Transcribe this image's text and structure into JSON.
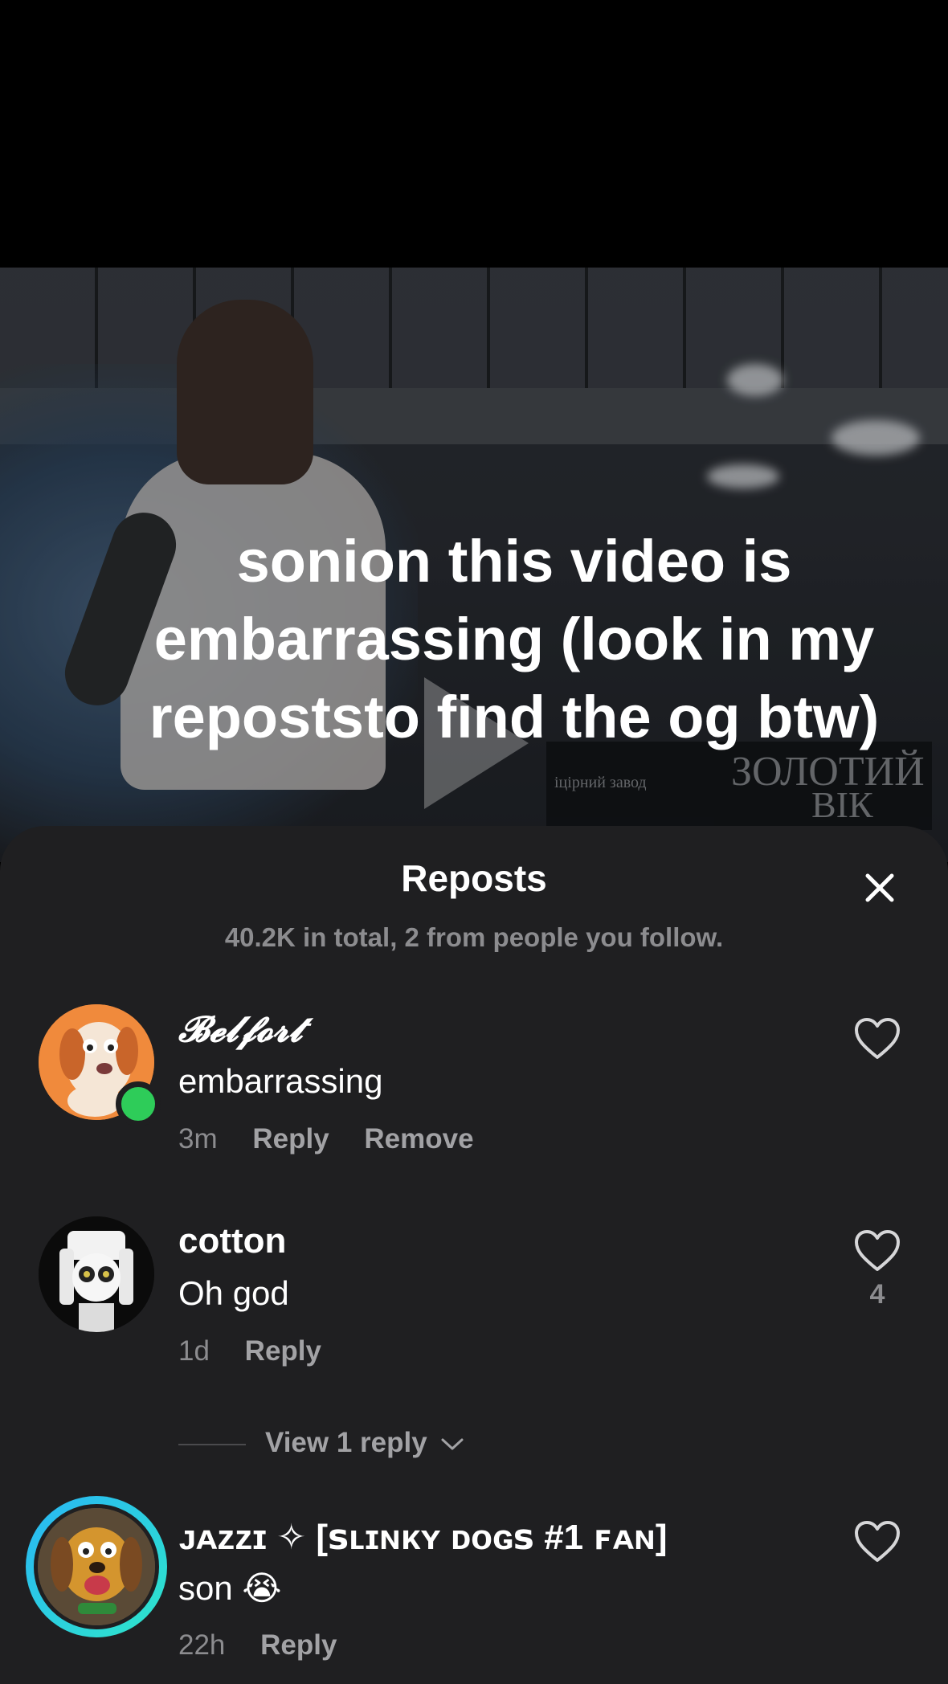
{
  "video": {
    "caption": "sonion this video is embarrassing (look in my repoststo find the og btw)",
    "sign_small": "іцірний завод",
    "sign_big_1": "ЗОЛОТИЙ",
    "sign_big_2": "ВІК"
  },
  "sheet": {
    "title": "Reposts",
    "subtitle": "40.2K in total, 2 from people you follow.",
    "view_replies_label": "View 1 reply"
  },
  "comments": [
    {
      "username": "𝓑𝓮𝓵𝓯𝓸𝓻𝓽",
      "text": "embarrassing",
      "time": "3m",
      "reply_label": "Reply",
      "remove_label": "Remove",
      "online": true
    },
    {
      "username": "cotton",
      "text": "Oh god",
      "time": "1d",
      "reply_label": "Reply",
      "likes": "4"
    },
    {
      "username": "ᴊᴀᴢᴢɪ ✧ [ꜱʟɪɴᴋʏ ᴅᴏɢꜱ #1 ꜰᴀɴ]",
      "text": "son 😭",
      "time": "22h",
      "reply_label": "Reply"
    }
  ],
  "icons": {
    "close": "close-icon",
    "like": "heart-outline-icon",
    "expand": "chevron-down-icon",
    "play": "play-icon"
  },
  "colors": {
    "sheet_bg": "#1f1f21",
    "muted_text": "#8c8c8f",
    "online": "#2ecc59",
    "avatar_ring_start": "#29b6f6",
    "avatar_ring_end": "#2ee6c9"
  }
}
